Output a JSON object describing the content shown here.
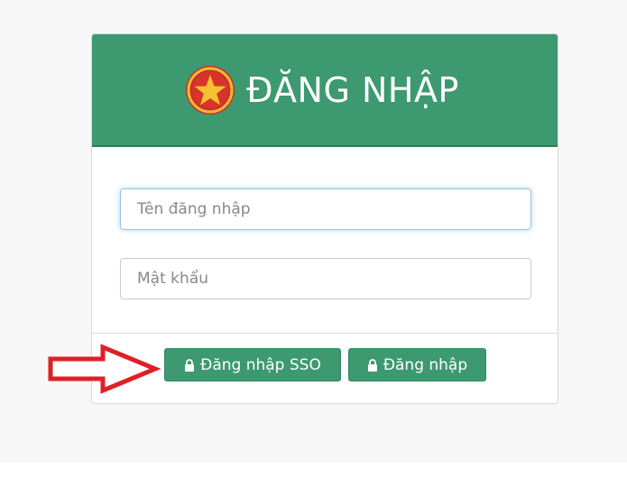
{
  "header": {
    "title": "ĐĂNG NHẬP",
    "emblem_icon": "national-emblem-icon"
  },
  "form": {
    "username_placeholder": "Tên đăng nhập",
    "password_placeholder": "Mật khẩu"
  },
  "buttons": {
    "sso_label": "Đăng nhập SSO",
    "login_label": "Đăng nhập",
    "icon": "lock-icon"
  },
  "colors": {
    "brand_green": "#3d9970",
    "arrow_red": "#e01f26",
    "emblem_red": "#d8352a",
    "emblem_gold": "#f2c230"
  }
}
